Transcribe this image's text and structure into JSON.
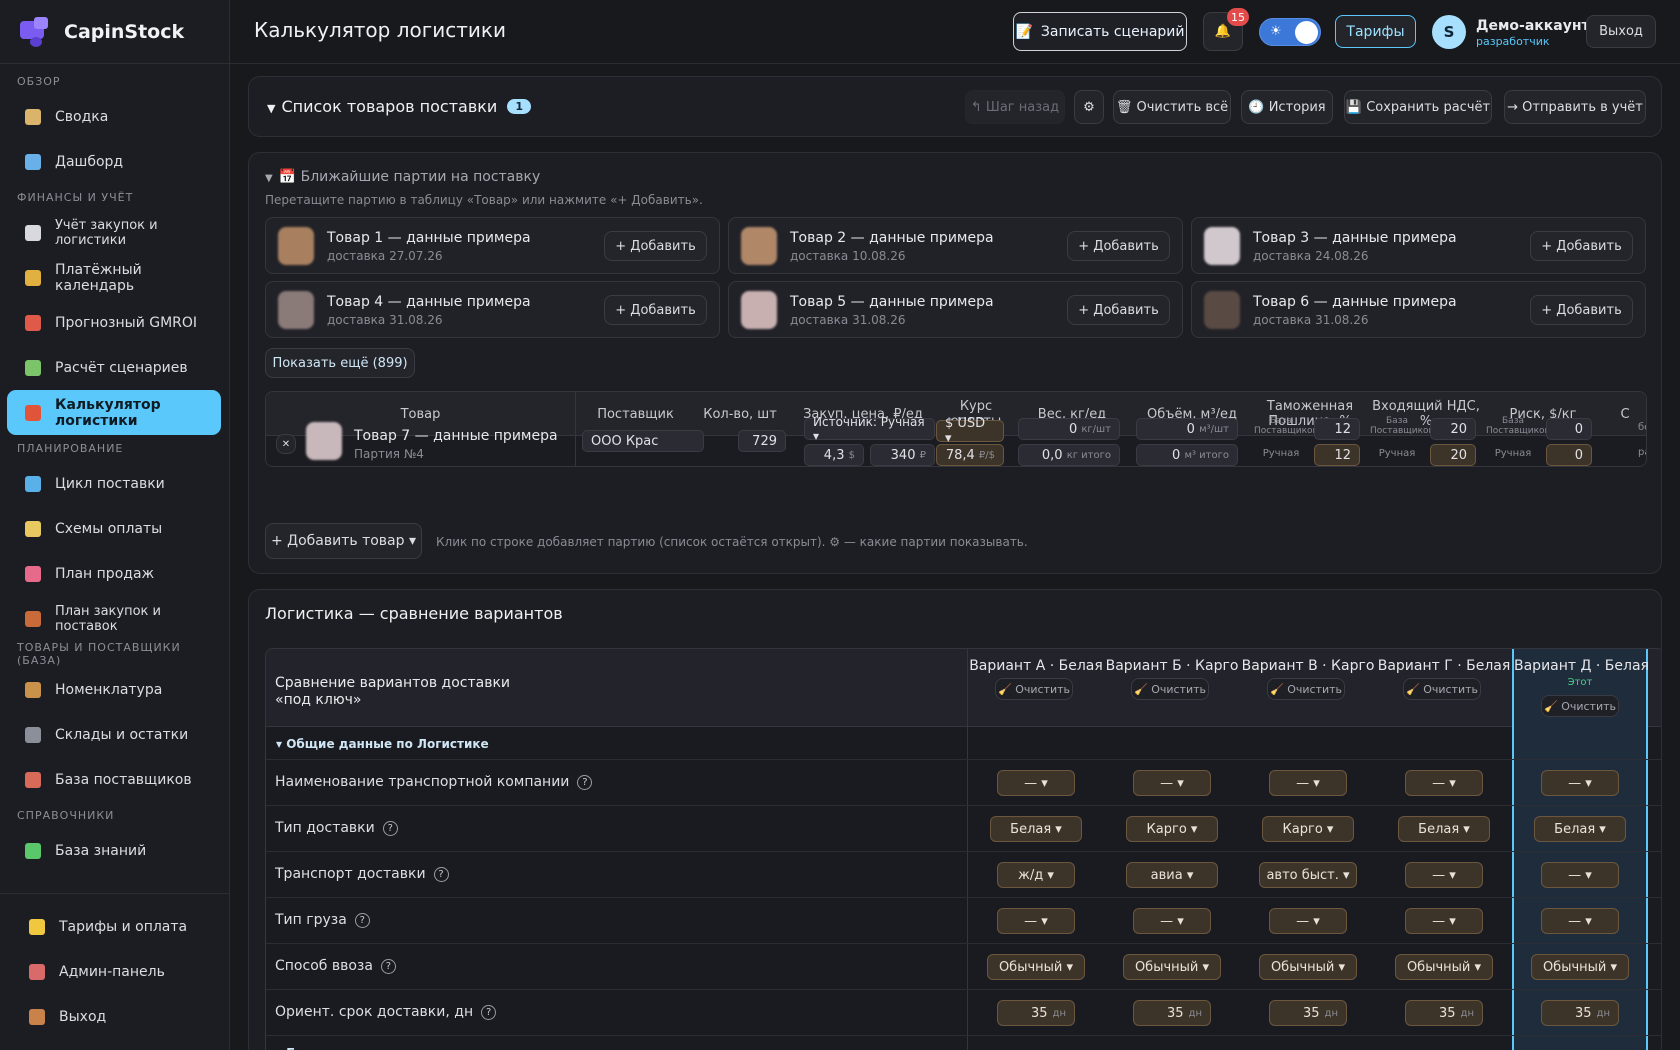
{
  "brand": {
    "name": "CapinStock"
  },
  "sidebar": {
    "sections": [
      {
        "title": "ОБЗОР",
        "items": [
          {
            "label": "Сводка",
            "icon": "clipboard-icon",
            "color": "#d9b46a"
          },
          {
            "label": "Дашборд",
            "icon": "bar-chart-icon",
            "color": "#6ab0e8"
          }
        ]
      },
      {
        "title": "ФИНАНСЫ И УЧЁТ",
        "items": [
          {
            "label": "Учёт закупок и логистики",
            "icon": "receipt-icon",
            "color": "#d8d8de",
            "small": true
          },
          {
            "label": "Платёжный календарь",
            "icon": "money-bag-icon",
            "color": "#e0b040"
          },
          {
            "label": "Прогнозный GMROI",
            "icon": "target-icon",
            "color": "#e05a4a"
          },
          {
            "label": "Расчёт сценариев",
            "icon": "pencil-icon",
            "color": "#7cc46a"
          },
          {
            "label": "Калькулятор логистики",
            "icon": "truck-icon",
            "color": "#e0553a",
            "active": true
          }
        ]
      },
      {
        "title": "ПЛАНИРОВАНИЕ",
        "items": [
          {
            "label": "Цикл поставки",
            "icon": "cycle-icon",
            "color": "#5ab0e8"
          },
          {
            "label": "Схемы оплаты",
            "icon": "card-icon",
            "color": "#e8c860"
          },
          {
            "label": "План продаж",
            "icon": "line-chart-icon",
            "color": "#e86a8a"
          },
          {
            "label": "План закупок и поставок",
            "icon": "abacus-icon",
            "color": "#c86a3a",
            "small": true
          }
        ]
      },
      {
        "title": "ТОВАРЫ И ПОСТАВЩИКИ (БАЗА)",
        "items": [
          {
            "label": "Номенклатура",
            "icon": "box-icon",
            "color": "#c8924a"
          },
          {
            "label": "Склады и остатки",
            "icon": "building-icon",
            "color": "#8a8f9a"
          },
          {
            "label": "База поставщиков",
            "icon": "factory-icon",
            "color": "#d86a5a"
          }
        ]
      },
      {
        "title": "СПРАВОЧНИКИ",
        "items": [
          {
            "label": "База знаний",
            "icon": "books-icon",
            "color": "#5ac86a"
          }
        ]
      }
    ],
    "bottom": [
      {
        "label": "Тарифы и оплата",
        "icon": "star-icon",
        "color": "#f0c840"
      },
      {
        "label": "Админ-панель",
        "icon": "shield-icon",
        "color": "#d86a6a"
      },
      {
        "label": "Выход",
        "icon": "door-icon",
        "color": "#c8824a"
      }
    ]
  },
  "header": {
    "title": "Калькулятор логистики",
    "record": "Записать сценарий",
    "notifications": "15",
    "tariffs": "Тарифы",
    "avatar_letter": "S",
    "account_name": "Демо-аккаунт",
    "account_role": "разработчик",
    "logout": "Выход"
  },
  "goods_panel": {
    "title": "Список товаров поставки",
    "count": "1",
    "toolbar": [
      "↰ Шаг назад",
      "⚙",
      "🗑 Очистить всё",
      "🕘 История",
      "💾 Сохранить расчёт",
      "→ Отправить в учёт"
    ]
  },
  "batches": {
    "title": "📅 Ближайшие партии на поставку",
    "hint": "Перетащите партию в таблицу «Товар» или нажмите «+ Добавить».",
    "add_label": "+ Добавить",
    "items": [
      {
        "name": "Товар 1 — данные примера",
        "date": "доставка 27.07.26",
        "color": "#a88060"
      },
      {
        "name": "Товар 2 — данные примера",
        "date": "доставка 10.08.26",
        "color": "#b08868"
      },
      {
        "name": "Товар 3 — данные примера",
        "date": "доставка 24.08.26",
        "color": "#d0c8cc"
      },
      {
        "name": "Товар 4 — данные примера",
        "date": "доставка 31.08.26",
        "color": "#8a7a78"
      },
      {
        "name": "Товар 5 — данные примера",
        "date": "доставка 31.08.26",
        "color": "#c8b0b0"
      },
      {
        "name": "Товар 6 — данные примера",
        "date": "доставка 31.08.26",
        "color": "#5a4a44"
      }
    ],
    "show_more": "Показать ещё (899)"
  },
  "goods_table": {
    "headers": [
      "Товар",
      "Поставщик",
      "Кол-во, шт",
      "Закуп. цена, ₽/ед",
      "Курс оплаты",
      "Вес, кг/ед",
      "Объём, м³/ед",
      "Таможенная Пошлина, %",
      "Входящий НДС, %",
      "Риск, $/кг",
      "С"
    ],
    "row": {
      "name": "Товар 7 — данные примера",
      "batch": "Партия №4",
      "supplier": "ООО Крас",
      "qty": "729",
      "source": "Источник: Ручная ▾",
      "price_usd": "4,3",
      "price_usd_unit": "$",
      "price_rub": "340",
      "price_rub_unit": "₽",
      "currency": "$ USD ▾",
      "rate": "78,4",
      "rate_unit": "₽/$",
      "weight": "0",
      "weight_unit": "кг/шт",
      "weight_total": "0,0",
      "weight_total_unit": "кг итого",
      "volume": "0",
      "volume_unit": "м³/шт",
      "volume_total": "0",
      "volume_total_unit": "м³ итого",
      "base_label": "База Поставщиков",
      "manual_label": "Ручная",
      "duty_base": "12",
      "duty_manual": "12",
      "vat_base": "20",
      "vat_manual": "20",
      "risk_base": "0",
      "risk_manual": "0",
      "cut1": "бе",
      "cut2": "ра",
      "remove": "✕"
    },
    "add_good": "+ Добавить товар ▾",
    "add_hint": "Клик по строке добавляет партию (список остаётся открыт). ⚙ — какие партии показывать."
  },
  "logistics": {
    "title": "Логистика — сравнение вариантов",
    "compare_title_1": "Сравнение вариантов доставки",
    "compare_title_2": "«под ключ»",
    "clear_label": "🧹 Очистить",
    "this_label": "Этот",
    "variants": [
      "Вариант А · Белая",
      "Вариант Б · Карго",
      "Вариант В · Карго",
      "Вариант Г · Белая",
      "Вариант Д · Белая"
    ],
    "group": "▾ Общие данные по Логистике",
    "rows": [
      {
        "label": "Наименование транспортной компании",
        "values": [
          "— ▾",
          "— ▾",
          "— ▾",
          "— ▾",
          "— ▾"
        ]
      },
      {
        "label": "Тип доставки",
        "values": [
          "Белая ▾",
          "Карго ▾",
          "Карго ▾",
          "Белая ▾",
          "Белая ▾"
        ]
      },
      {
        "label": "Транспорт доставки",
        "values": [
          "ж/д ▾",
          "авиа ▾",
          "авто быст. ▾",
          "— ▾",
          "— ▾"
        ]
      },
      {
        "label": "Тип груза",
        "values": [
          "— ▾",
          "— ▾",
          "— ▾",
          "— ▾",
          "— ▾"
        ]
      },
      {
        "label": "Способ ввоза",
        "values": [
          "Обычный ▾",
          "Обычный ▾",
          "Обычный ▾",
          "Обычный ▾",
          "Обычный ▾"
        ]
      },
      {
        "label": "Ориент. срок доставки, дн",
        "values": [
          "35",
          "35",
          "35",
          "35",
          "35"
        ],
        "unit": "дн"
      }
    ],
    "next_group": "▸ Белая логистика"
  }
}
